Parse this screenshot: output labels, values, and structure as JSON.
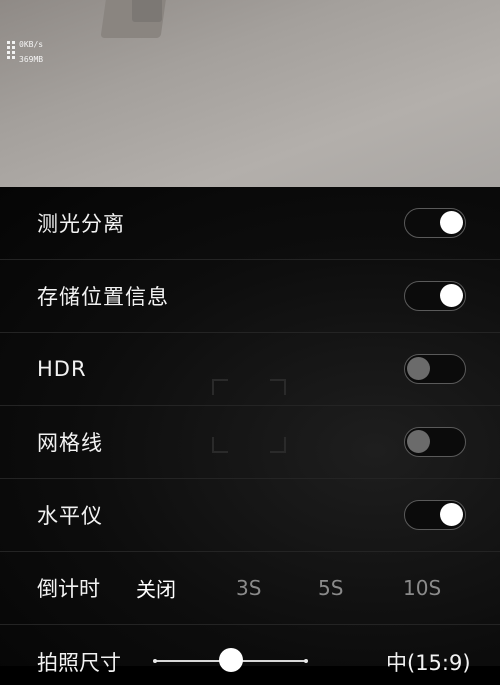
{
  "status": {
    "net_speed": "0KB/s",
    "memory": "369MB"
  },
  "settings": [
    {
      "label": "测光分离",
      "state": "on"
    },
    {
      "label": "存储位置信息",
      "state": "on"
    },
    {
      "label": "HDR",
      "state": "off"
    },
    {
      "label": "网格线",
      "state": "off"
    },
    {
      "label": "水平仪",
      "state": "on"
    }
  ],
  "timer": {
    "label": "倒计时",
    "options": [
      "关闭",
      "3S",
      "5S",
      "10S"
    ],
    "selected": "关闭"
  },
  "photo_size": {
    "label": "拍照尺寸",
    "value": "中(15:9)",
    "slider_level": 0.5
  },
  "colors": {
    "toggle_on_knob": "#ffffff",
    "toggle_off_knob": "#6b6b6b",
    "inactive_text": "#8a8a8a"
  }
}
